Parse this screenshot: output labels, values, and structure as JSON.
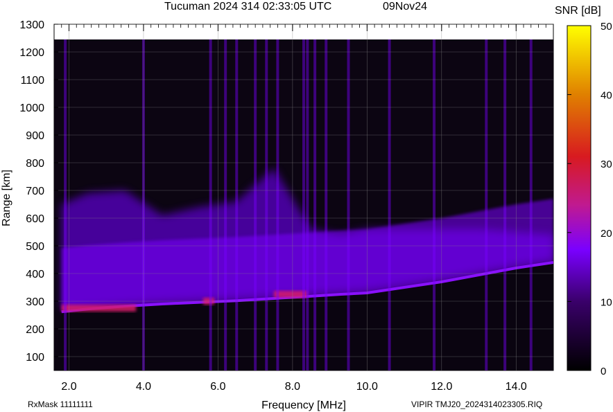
{
  "chart_data": {
    "type": "heatmap",
    "title": "Tucuman 2024 314 02:33:05 UTC",
    "date": "09Nov24",
    "xlabel": "Frequency [MHz]",
    "ylabel": "Range [km]",
    "xlim": [
      1.6,
      15.0
    ],
    "ylim": [
      50,
      1300
    ],
    "x_ticks": [
      "2.0",
      "4.0",
      "6.0",
      "8.0",
      "10.0",
      "12.0",
      "14.0"
    ],
    "x_tick_values": [
      2,
      4,
      6,
      8,
      10,
      12,
      14
    ],
    "y_ticks": [
      "100",
      "200",
      "300",
      "400",
      "500",
      "600",
      "700",
      "800",
      "900",
      "1000",
      "1100",
      "1200",
      "1300"
    ],
    "y_tick_values": [
      100,
      200,
      300,
      400,
      500,
      600,
      700,
      800,
      900,
      1000,
      1100,
      1200,
      1300
    ],
    "data_max_range": 1245,
    "colorbar": {
      "label": "SNR [dB]",
      "range": [
        0,
        50
      ],
      "ticks": [
        "0",
        "10",
        "20",
        "30",
        "40",
        "50"
      ],
      "tick_values": [
        0,
        10,
        20,
        30,
        40,
        50
      ],
      "colors": [
        "#000000",
        "#3a006a",
        "#7a00ff",
        "#d81a6a",
        "#e05000",
        "#ffff00"
      ]
    },
    "trace": {
      "name": "echo",
      "points": [
        {
          "f": 1.8,
          "r": 262
        },
        {
          "f": 2.5,
          "r": 272
        },
        {
          "f": 3.5,
          "r": 282
        },
        {
          "f": 4.5,
          "r": 290
        },
        {
          "f": 5.5,
          "r": 296
        },
        {
          "f": 6.5,
          "r": 302
        },
        {
          "f": 7.5,
          "r": 310
        },
        {
          "f": 8.5,
          "r": 318
        },
        {
          "f": 9.3,
          "r": 325
        },
        {
          "f": 10.0,
          "r": 330
        },
        {
          "f": 11.0,
          "r": 350
        },
        {
          "f": 12.0,
          "r": 370
        },
        {
          "f": 13.0,
          "r": 395
        },
        {
          "f": 14.0,
          "r": 420
        },
        {
          "f": 15.0,
          "r": 440
        }
      ]
    },
    "strong_echoes": [
      {
        "f_from": 1.8,
        "f_to": 3.8,
        "range": 275,
        "snr": 28
      },
      {
        "f_from": 5.6,
        "f_to": 5.9,
        "range": 300,
        "snr": 25
      },
      {
        "f_from": 7.5,
        "f_to": 8.4,
        "range": 325,
        "snr": 27
      }
    ],
    "interference_frequencies": [
      1.9,
      4.0,
      5.8,
      6.2,
      6.5,
      7.0,
      7.3,
      7.6,
      8.3,
      8.4,
      8.6,
      8.9,
      9.5,
      10.6,
      11.8,
      13.2,
      13.7,
      14.4
    ]
  },
  "footer": {
    "rx_mask": "RxMask 11111111",
    "file": "VIPIR  TMJ20_2024314023305.RIQ"
  }
}
